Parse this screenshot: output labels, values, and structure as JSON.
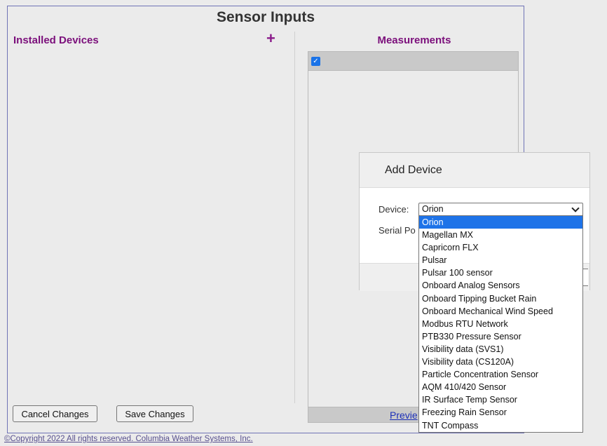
{
  "page": {
    "title": "Sensor Inputs",
    "installed_devices_label": "Installed Devices",
    "add_symbol": "+",
    "measurements_label": "Measurements",
    "preview_link": "Previe",
    "cancel_label": "Cancel Changes",
    "save_label": "Save Changes",
    "copyright": "©Copyright 2022 All rights reserved. Columbia Weather Systems, Inc.",
    "checkbox_checked": true
  },
  "modal": {
    "title": "Add Device",
    "device_label": "Device:",
    "serial_label": "Serial Po",
    "selected_device": "Orion"
  },
  "dropdown": {
    "options": [
      "Orion",
      "Magellan MX",
      "Capricorn FLX",
      "Pulsar",
      "Pulsar 100 sensor",
      "Onboard Analog Sensors",
      "Onboard Tipping Bucket Rain",
      "Onboard Mechanical Wind Speed",
      "Modbus RTU Network",
      "PTB330 Pressure Sensor",
      "Visibility data (SVS1)",
      "Visibility data (CS120A)",
      "Particle Concentration Sensor",
      "AQM 410/420 Sensor",
      "IR Surface Temp Sensor",
      "Freezing Rain Sensor",
      "TNT Compass"
    ],
    "highlighted_index": 0
  },
  "colors": {
    "section_heading": "#7b0f7b",
    "selection": "#1e73e8",
    "link": "#1c2fb8"
  }
}
